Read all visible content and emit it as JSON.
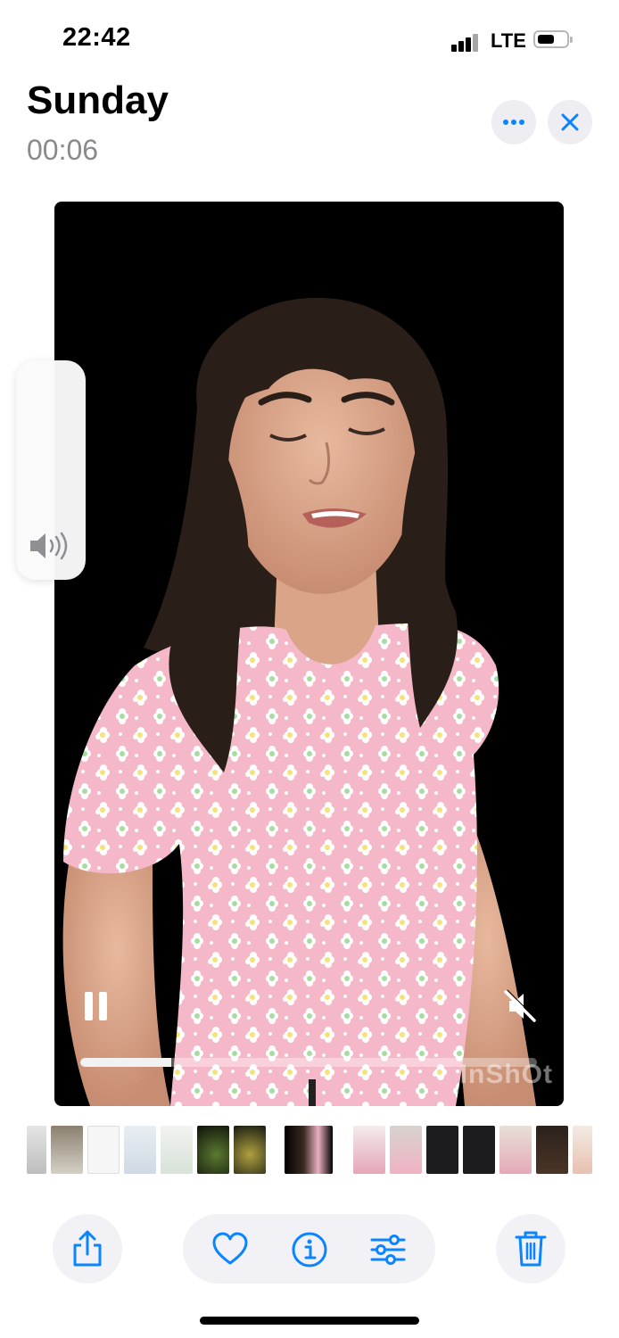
{
  "status_bar": {
    "time": "22:42",
    "network": "LTE",
    "battery_level": 0.55
  },
  "header": {
    "title": "Sunday",
    "subtitle": "00:06"
  },
  "header_buttons": {
    "more_icon": "ellipsis-icon",
    "close_icon": "close-icon"
  },
  "video": {
    "progress": 0.2,
    "watermark": "InShOt",
    "paused": false,
    "muted": true
  },
  "volume_hud": {
    "icon": "speaker-icon"
  },
  "toolbar": {
    "share_icon": "share-icon",
    "favorite_icon": "heart-icon",
    "info_icon": "info-icon",
    "adjust_icon": "sliders-icon",
    "delete_icon": "trash-icon"
  },
  "colors": {
    "accent": "#0a84ff",
    "secondary_text": "#8a8a8e",
    "button_bg": "#f2f2f6"
  }
}
